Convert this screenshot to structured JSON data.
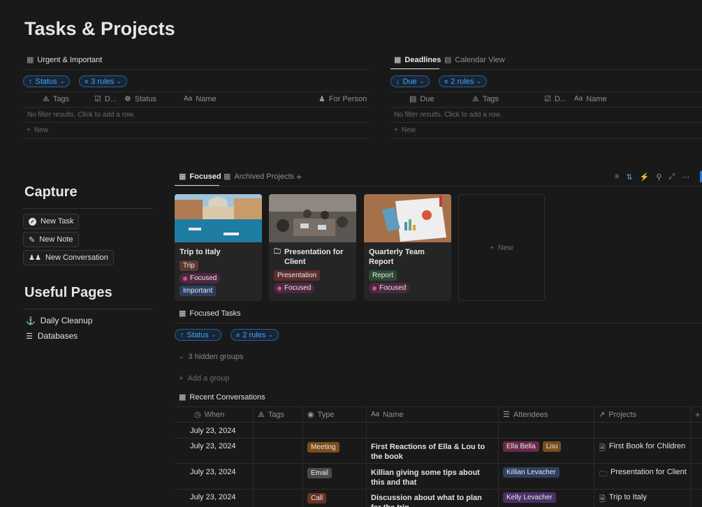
{
  "page": {
    "title": "Tasks & Projects"
  },
  "urgent": {
    "view_label": "Urgent & Important",
    "sort_pill": "Status",
    "filter_pill": "3 rules",
    "columns": [
      "Tags",
      "D...",
      "Status",
      "Name",
      "For Person"
    ],
    "empty_text": "No filter results. Click to add a row.",
    "new_label": "New"
  },
  "deadlines": {
    "tabs": [
      "Deadlines",
      "Calendar View"
    ],
    "sort_pill": "Due",
    "filter_pill": "2 rules",
    "columns": [
      "Due",
      "Tags",
      "D...",
      "Name"
    ],
    "empty_text": "No filter results. Click to add a row.",
    "new_label": "New"
  },
  "capture": {
    "heading": "Capture",
    "buttons": [
      "New Task",
      "New Note",
      "New Conversation"
    ]
  },
  "useful": {
    "heading": "Useful Pages",
    "links": [
      "Daily Cleanup",
      "Databases"
    ]
  },
  "projects": {
    "tabs": [
      "Focused",
      "Archived Projects"
    ],
    "add_tab": "+",
    "cards": [
      {
        "title": "Trip to Italy",
        "tags": [
          {
            "label": "Trip",
            "color": "#5c3a2e"
          },
          {
            "label": "Focused",
            "color": "#4e2740",
            "dot": "#c4558f"
          },
          {
            "label": "Important",
            "color": "#2b3f60"
          }
        ]
      },
      {
        "title": "Presentation for Client",
        "tags": [
          {
            "label": "Presentation",
            "color": "#5c2c2c"
          },
          {
            "label": "Focused",
            "color": "#4e2740",
            "dot": "#c4558f"
          }
        ]
      },
      {
        "title": "Quarterly Team Report",
        "tags": [
          {
            "label": "Report",
            "color": "#2b4a32"
          },
          {
            "label": "Focused",
            "color": "#4e2740",
            "dot": "#c4558f"
          }
        ]
      }
    ],
    "new_card": "New"
  },
  "focused_tasks": {
    "label": "Focused Tasks",
    "sort_pill": "Status",
    "filter_pill": "2 rules",
    "hidden_groups": "3 hidden groups",
    "add_group": "Add a group"
  },
  "conversations": {
    "label": "Recent Conversations",
    "columns": [
      "When",
      "Tags",
      "Type",
      "Name",
      "Attendees",
      "Projects"
    ],
    "rows": [
      {
        "when": "July 23, 2024",
        "type": "",
        "type_color": "",
        "name": "",
        "attendees": [],
        "project": ""
      },
      {
        "when": "July 23, 2024",
        "type": "Meeting",
        "type_color": "#7a4e1c",
        "name": "First Reactions of Ella & Lou to the book",
        "attendees": [
          {
            "label": "Ella Bella",
            "color": "#6a2a4a"
          },
          {
            "label": "Lou",
            "color": "#7a4e1c"
          }
        ],
        "project": "First Book for Children"
      },
      {
        "when": "July 23, 2024",
        "type": "Email",
        "type_color": "#4a4a4a",
        "name": "Killian giving some tips about this and that",
        "attendees": [
          {
            "label": "Killian Levacher",
            "color": "#2b3f60"
          }
        ],
        "project": "Presentation for Client"
      },
      {
        "when": "July 23, 2024",
        "type": "Call",
        "type_color": "#6b3222",
        "name": "Discussion about what to plan for the trip",
        "attendees": [
          {
            "label": "Kelly Levacher",
            "color": "#4a2f66"
          }
        ],
        "project": "Trip to Italy"
      }
    ]
  }
}
